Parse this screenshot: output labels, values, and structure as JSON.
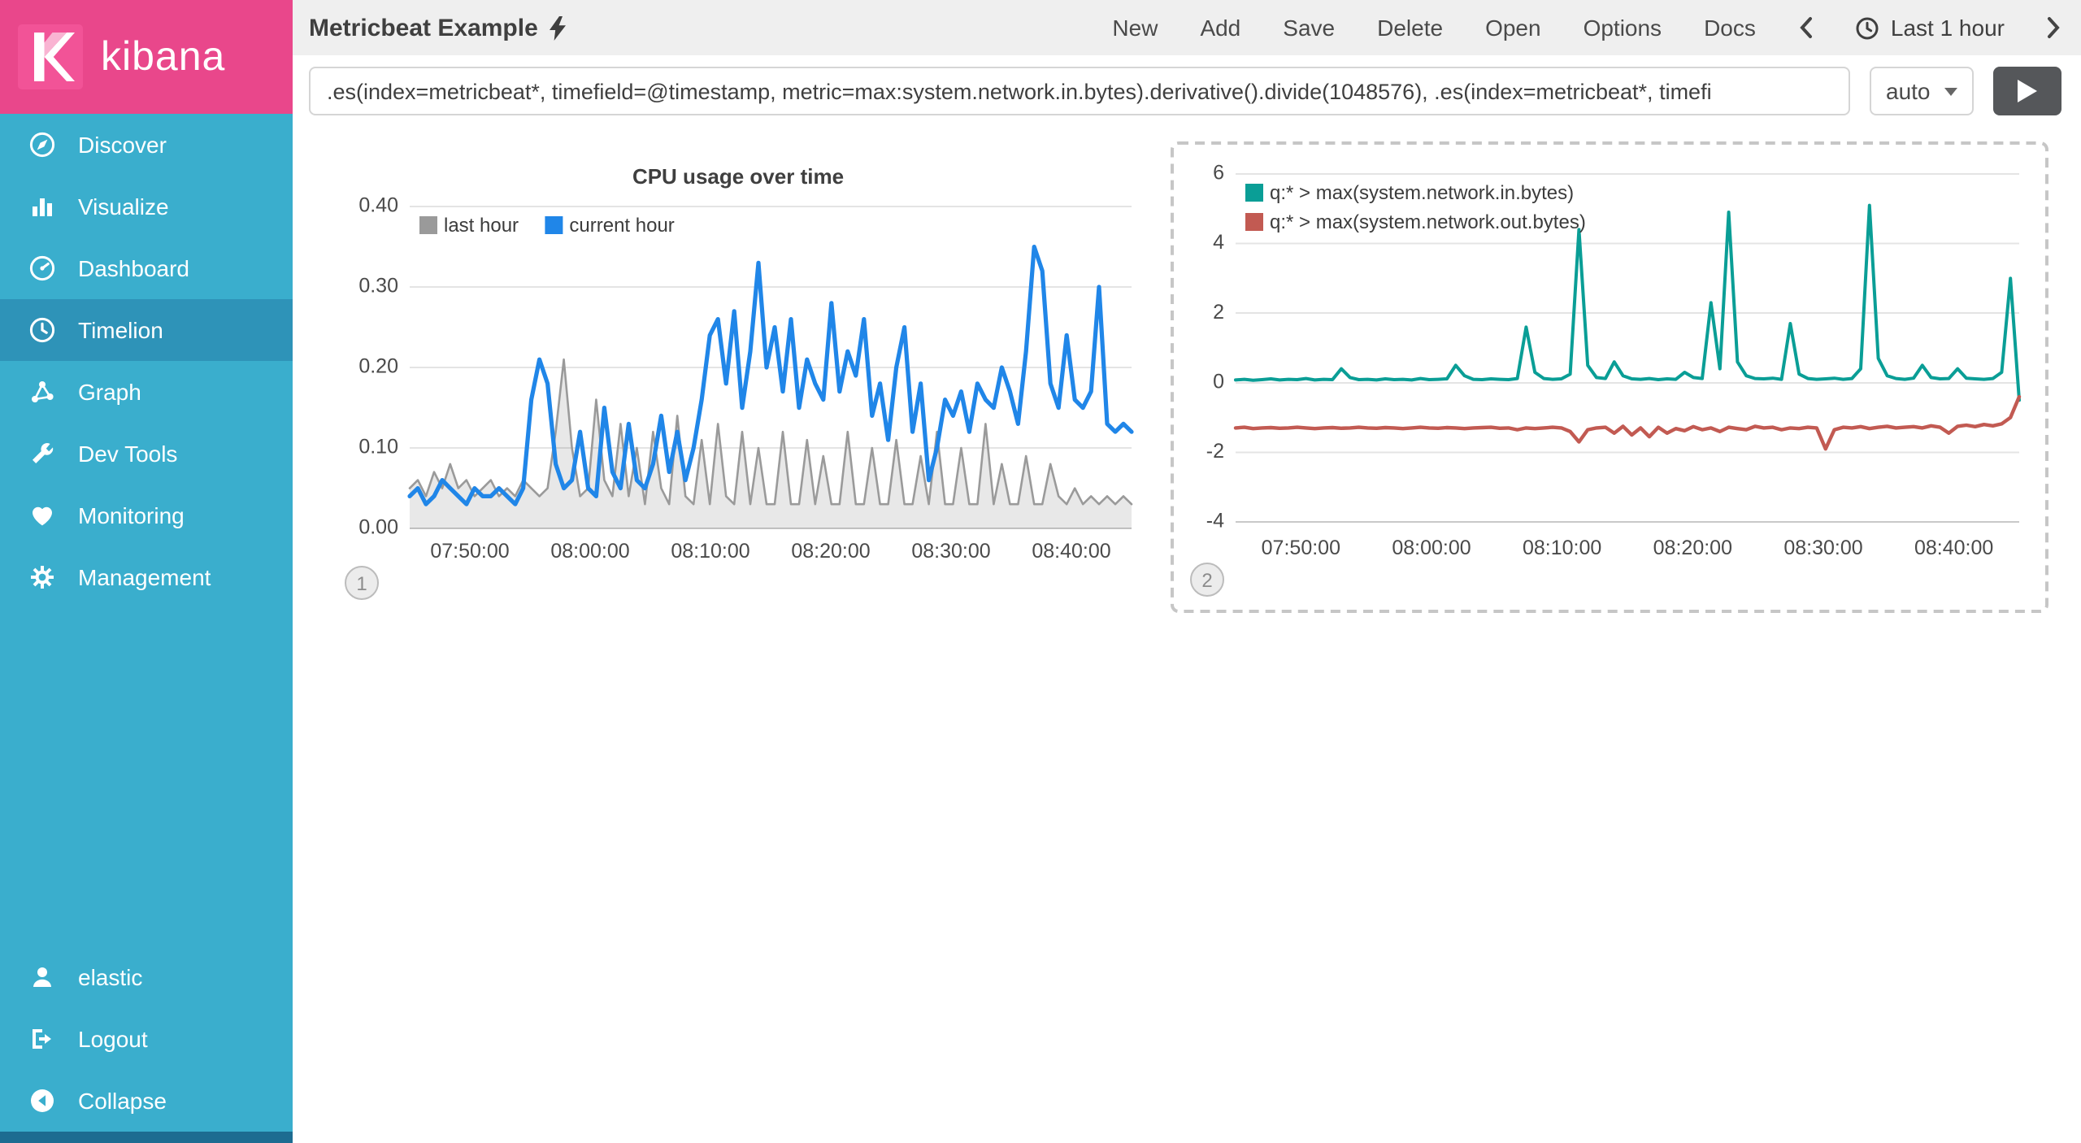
{
  "brand": {
    "name": "kibana"
  },
  "colors": {
    "sidebar": "#3aaecd",
    "sidebar_selected": "#2e93b8",
    "brand_pink": "#e9478b",
    "series_gray": "#9a9a9a",
    "series_blue": "#2086e8",
    "series_teal": "#0a9e96",
    "series_red": "#c25a52"
  },
  "sidebar": {
    "items": [
      {
        "label": "Discover",
        "icon": "discover-icon",
        "selected": false
      },
      {
        "label": "Visualize",
        "icon": "visualize-icon",
        "selected": false
      },
      {
        "label": "Dashboard",
        "icon": "dashboard-icon",
        "selected": false
      },
      {
        "label": "Timelion",
        "icon": "timelion-icon",
        "selected": true
      },
      {
        "label": "Graph",
        "icon": "graph-icon",
        "selected": false
      },
      {
        "label": "Dev Tools",
        "icon": "dev-tools-icon",
        "selected": false
      },
      {
        "label": "Monitoring",
        "icon": "monitoring-icon",
        "selected": false
      },
      {
        "label": "Management",
        "icon": "management-icon",
        "selected": false
      }
    ],
    "footer": [
      {
        "label": "elastic",
        "icon": "user-icon"
      },
      {
        "label": "Logout",
        "icon": "logout-icon"
      },
      {
        "label": "Collapse",
        "icon": "collapse-icon"
      }
    ]
  },
  "topbar": {
    "title": "Metricbeat Example",
    "menu": [
      "New",
      "Add",
      "Save",
      "Delete",
      "Open",
      "Options",
      "Docs"
    ],
    "time_picker": "Last 1 hour"
  },
  "querybar": {
    "query": ".es(index=metricbeat*, timefield=@timestamp, metric=max:system.network.in.bytes).derivative().divide(1048576), .es(index=metricbeat*, timefi",
    "interval": "auto"
  },
  "chart_data": [
    {
      "type": "line",
      "title": "CPU usage over time",
      "panel_number": "1",
      "selected": false,
      "x_start": "07:45:00",
      "x_end": "08:45:00",
      "x_span_minutes": 60,
      "xticks": [
        {
          "minute": 5,
          "label": "07:50:00"
        },
        {
          "minute": 15,
          "label": "08:00:00"
        },
        {
          "minute": 25,
          "label": "08:10:00"
        },
        {
          "minute": 35,
          "label": "08:20:00"
        },
        {
          "minute": 45,
          "label": "08:30:00"
        },
        {
          "minute": 55,
          "label": "08:40:00"
        }
      ],
      "ylim": [
        0,
        0.4
      ],
      "yticks": [
        {
          "v": 0.0,
          "label": "0.00"
        },
        {
          "v": 0.1,
          "label": "0.10"
        },
        {
          "v": 0.2,
          "label": "0.20"
        },
        {
          "v": 0.3,
          "label": "0.30"
        },
        {
          "v": 0.4,
          "label": "0.40"
        }
      ],
      "legend_position": "top-left-horizontal",
      "grid": true,
      "series": [
        {
          "name": "last hour",
          "color": "#9a9a9a",
          "fill": "rgba(0,0,0,0.09)",
          "width": 1.3,
          "values": [
            0.05,
            0.06,
            0.04,
            0.07,
            0.05,
            0.08,
            0.05,
            0.06,
            0.04,
            0.05,
            0.06,
            0.04,
            0.05,
            0.04,
            0.06,
            0.05,
            0.04,
            0.05,
            0.12,
            0.21,
            0.1,
            0.04,
            0.05,
            0.16,
            0.06,
            0.04,
            0.13,
            0.04,
            0.1,
            0.03,
            0.12,
            0.05,
            0.03,
            0.14,
            0.04,
            0.03,
            0.11,
            0.03,
            0.13,
            0.04,
            0.03,
            0.12,
            0.03,
            0.1,
            0.03,
            0.03,
            0.12,
            0.03,
            0.03,
            0.11,
            0.03,
            0.09,
            0.03,
            0.03,
            0.12,
            0.03,
            0.03,
            0.1,
            0.03,
            0.03,
            0.11,
            0.03,
            0.03,
            0.09,
            0.03,
            0.12,
            0.03,
            0.03,
            0.1,
            0.03,
            0.03,
            0.13,
            0.03,
            0.08,
            0.03,
            0.03,
            0.09,
            0.03,
            0.03,
            0.08,
            0.04,
            0.03,
            0.05,
            0.03,
            0.04,
            0.03,
            0.04,
            0.03,
            0.04,
            0.03
          ]
        },
        {
          "name": "current hour",
          "color": "#2086e8",
          "fill": null,
          "width": 2.6,
          "values": [
            0.04,
            0.05,
            0.03,
            0.04,
            0.06,
            0.05,
            0.04,
            0.03,
            0.05,
            0.04,
            0.04,
            0.05,
            0.04,
            0.03,
            0.05,
            0.16,
            0.21,
            0.18,
            0.08,
            0.05,
            0.06,
            0.12,
            0.05,
            0.04,
            0.15,
            0.07,
            0.05,
            0.13,
            0.06,
            0.05,
            0.08,
            0.14,
            0.07,
            0.12,
            0.06,
            0.1,
            0.16,
            0.24,
            0.26,
            0.18,
            0.27,
            0.15,
            0.22,
            0.33,
            0.2,
            0.25,
            0.17,
            0.26,
            0.15,
            0.21,
            0.18,
            0.16,
            0.28,
            0.17,
            0.22,
            0.19,
            0.26,
            0.14,
            0.18,
            0.11,
            0.2,
            0.25,
            0.12,
            0.18,
            0.06,
            0.1,
            0.16,
            0.14,
            0.17,
            0.12,
            0.18,
            0.16,
            0.15,
            0.2,
            0.17,
            0.13,
            0.22,
            0.35,
            0.32,
            0.18,
            0.15,
            0.24,
            0.16,
            0.15,
            0.17,
            0.3,
            0.13,
            0.12,
            0.13,
            0.12
          ]
        }
      ]
    },
    {
      "type": "line",
      "title": null,
      "panel_number": "2",
      "selected": true,
      "x_start": "07:45:00",
      "x_end": "08:45:00",
      "x_span_minutes": 60,
      "xticks": [
        {
          "minute": 5,
          "label": "07:50:00"
        },
        {
          "minute": 15,
          "label": "08:00:00"
        },
        {
          "minute": 25,
          "label": "08:10:00"
        },
        {
          "minute": 35,
          "label": "08:20:00"
        },
        {
          "minute": 45,
          "label": "08:30:00"
        },
        {
          "minute": 55,
          "label": "08:40:00"
        }
      ],
      "ylim": [
        -4,
        6
      ],
      "yticks": [
        {
          "v": 6,
          "label": "6"
        },
        {
          "v": 4,
          "label": "4"
        },
        {
          "v": 2,
          "label": "2"
        },
        {
          "v": 0,
          "label": "0"
        },
        {
          "v": -2,
          "label": "-2"
        },
        {
          "v": -4,
          "label": "-4"
        }
      ],
      "legend_position": "top-left-vertical",
      "grid": true,
      "series": [
        {
          "name": "q:* > max(system.network.in.bytes)",
          "color": "#0a9e96",
          "fill": null,
          "width": 2,
          "values": [
            0.08,
            0.1,
            0.07,
            0.09,
            0.11,
            0.08,
            0.1,
            0.09,
            0.12,
            0.08,
            0.1,
            0.09,
            0.4,
            0.15,
            0.09,
            0.1,
            0.08,
            0.11,
            0.09,
            0.1,
            0.08,
            0.12,
            0.09,
            0.1,
            0.11,
            0.5,
            0.2,
            0.1,
            0.09,
            0.11,
            0.1,
            0.09,
            0.12,
            1.6,
            0.3,
            0.12,
            0.1,
            0.11,
            0.25,
            4.4,
            0.5,
            0.15,
            0.12,
            0.6,
            0.2,
            0.11,
            0.1,
            0.12,
            0.09,
            0.11,
            0.1,
            0.3,
            0.15,
            0.12,
            2.3,
            0.4,
            4.9,
            0.6,
            0.2,
            0.12,
            0.11,
            0.13,
            0.1,
            1.7,
            0.25,
            0.12,
            0.1,
            0.11,
            0.13,
            0.1,
            0.12,
            0.4,
            5.1,
            0.7,
            0.2,
            0.12,
            0.1,
            0.13,
            0.5,
            0.15,
            0.11,
            0.12,
            0.4,
            0.13,
            0.11,
            0.1,
            0.12,
            0.3,
            3.0,
            -0.5
          ]
        },
        {
          "name": "q:* > max(system.network.out.bytes)",
          "color": "#c25a52",
          "fill": null,
          "width": 2.2,
          "values": [
            -1.3,
            -1.28,
            -1.32,
            -1.3,
            -1.29,
            -1.31,
            -1.3,
            -1.28,
            -1.3,
            -1.32,
            -1.3,
            -1.29,
            -1.31,
            -1.3,
            -1.28,
            -1.3,
            -1.31,
            -1.29,
            -1.3,
            -1.32,
            -1.3,
            -1.28,
            -1.3,
            -1.31,
            -1.29,
            -1.3,
            -1.32,
            -1.3,
            -1.29,
            -1.28,
            -1.31,
            -1.3,
            -1.35,
            -1.3,
            -1.32,
            -1.3,
            -1.28,
            -1.3,
            -1.4,
            -1.7,
            -1.35,
            -1.3,
            -1.28,
            -1.45,
            -1.25,
            -1.5,
            -1.3,
            -1.55,
            -1.28,
            -1.45,
            -1.32,
            -1.38,
            -1.26,
            -1.35,
            -1.3,
            -1.4,
            -1.28,
            -1.32,
            -1.35,
            -1.25,
            -1.3,
            -1.28,
            -1.35,
            -1.3,
            -1.32,
            -1.28,
            -1.3,
            -1.9,
            -1.35,
            -1.28,
            -1.3,
            -1.26,
            -1.32,
            -1.28,
            -1.25,
            -1.3,
            -1.28,
            -1.26,
            -1.3,
            -1.24,
            -1.28,
            -1.45,
            -1.25,
            -1.22,
            -1.26,
            -1.2,
            -1.24,
            -1.18,
            -1.0,
            -0.4
          ]
        }
      ]
    }
  ]
}
